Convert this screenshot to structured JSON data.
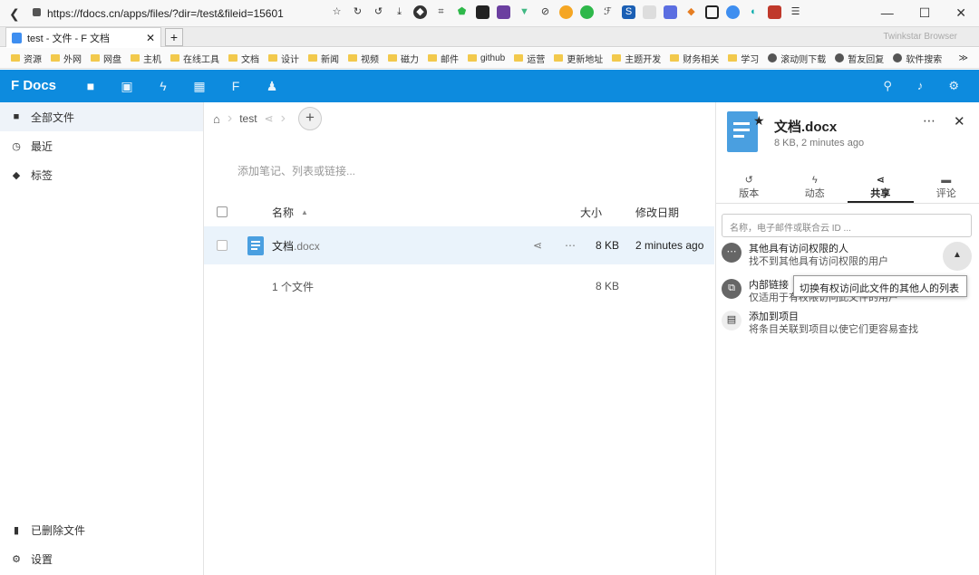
{
  "browser": {
    "url": "https://fdocs.cn/apps/files/?dir=/test&fileid=15601",
    "tab_title": "test - 文件 - F 文档",
    "tab_close": "✕",
    "new_tab": "+",
    "browser_brand": "Twinkstar Browser",
    "bookmarks": [
      "资源",
      "外网",
      "网盘",
      "主机",
      "在线工具",
      "文档",
      "设计",
      "新闻",
      "视频",
      "磁力",
      "邮件",
      "github",
      "运营",
      "更新地址",
      "主题开发",
      "财务相关",
      "学习",
      "滚动则下载",
      "暂友回复",
      "软件搜索"
    ],
    "bookmarks_more": "≫"
  },
  "app": {
    "logo": "F Docs",
    "accent": "#0d8bde"
  },
  "sidebar": {
    "items": [
      {
        "label": "全部文件",
        "icon": "folder-icon",
        "active": true
      },
      {
        "label": "最近",
        "icon": "clock-icon"
      },
      {
        "label": "标签",
        "icon": "tag-icon"
      }
    ],
    "bottom": [
      {
        "label": "已删除文件",
        "icon": "trash-icon"
      },
      {
        "label": "设置",
        "icon": "gear-icon"
      }
    ]
  },
  "main": {
    "breadcrumb_folder": "test",
    "notes_placeholder": "添加笔记、列表或链接...",
    "columns": {
      "name": "名称",
      "size": "大小",
      "modified": "修改日期"
    },
    "files": [
      {
        "name": "文档",
        "ext": ".docx",
        "size": "8 KB",
        "modified": "2 minutes ago"
      }
    ],
    "summary": {
      "count": "1 个文件",
      "size": "8 KB"
    }
  },
  "panel": {
    "file_name": "文档.docx",
    "file_meta": "8 KB, 2 minutes ago",
    "tabs": [
      {
        "label": "版本",
        "icon": "history-icon"
      },
      {
        "label": "动态",
        "icon": "activity-icon"
      },
      {
        "label": "共享",
        "icon": "share-icon",
        "active": true
      },
      {
        "label": "评论",
        "icon": "comment-icon"
      }
    ],
    "share_placeholder": "名称，电子邮件或联合云 ID ...",
    "others_title": "其他具有访问权限的人",
    "others_sub": "找不到其他具有访问权限的用户",
    "internal_title": "内部链接",
    "internal_sub": "仅适用于有权限访问此文件的用户",
    "project_title": "添加到项目",
    "project_sub": "将条目关联到项目以使它们更容易查找",
    "tooltip": "切换有权访问此文件的其他人的列表"
  }
}
